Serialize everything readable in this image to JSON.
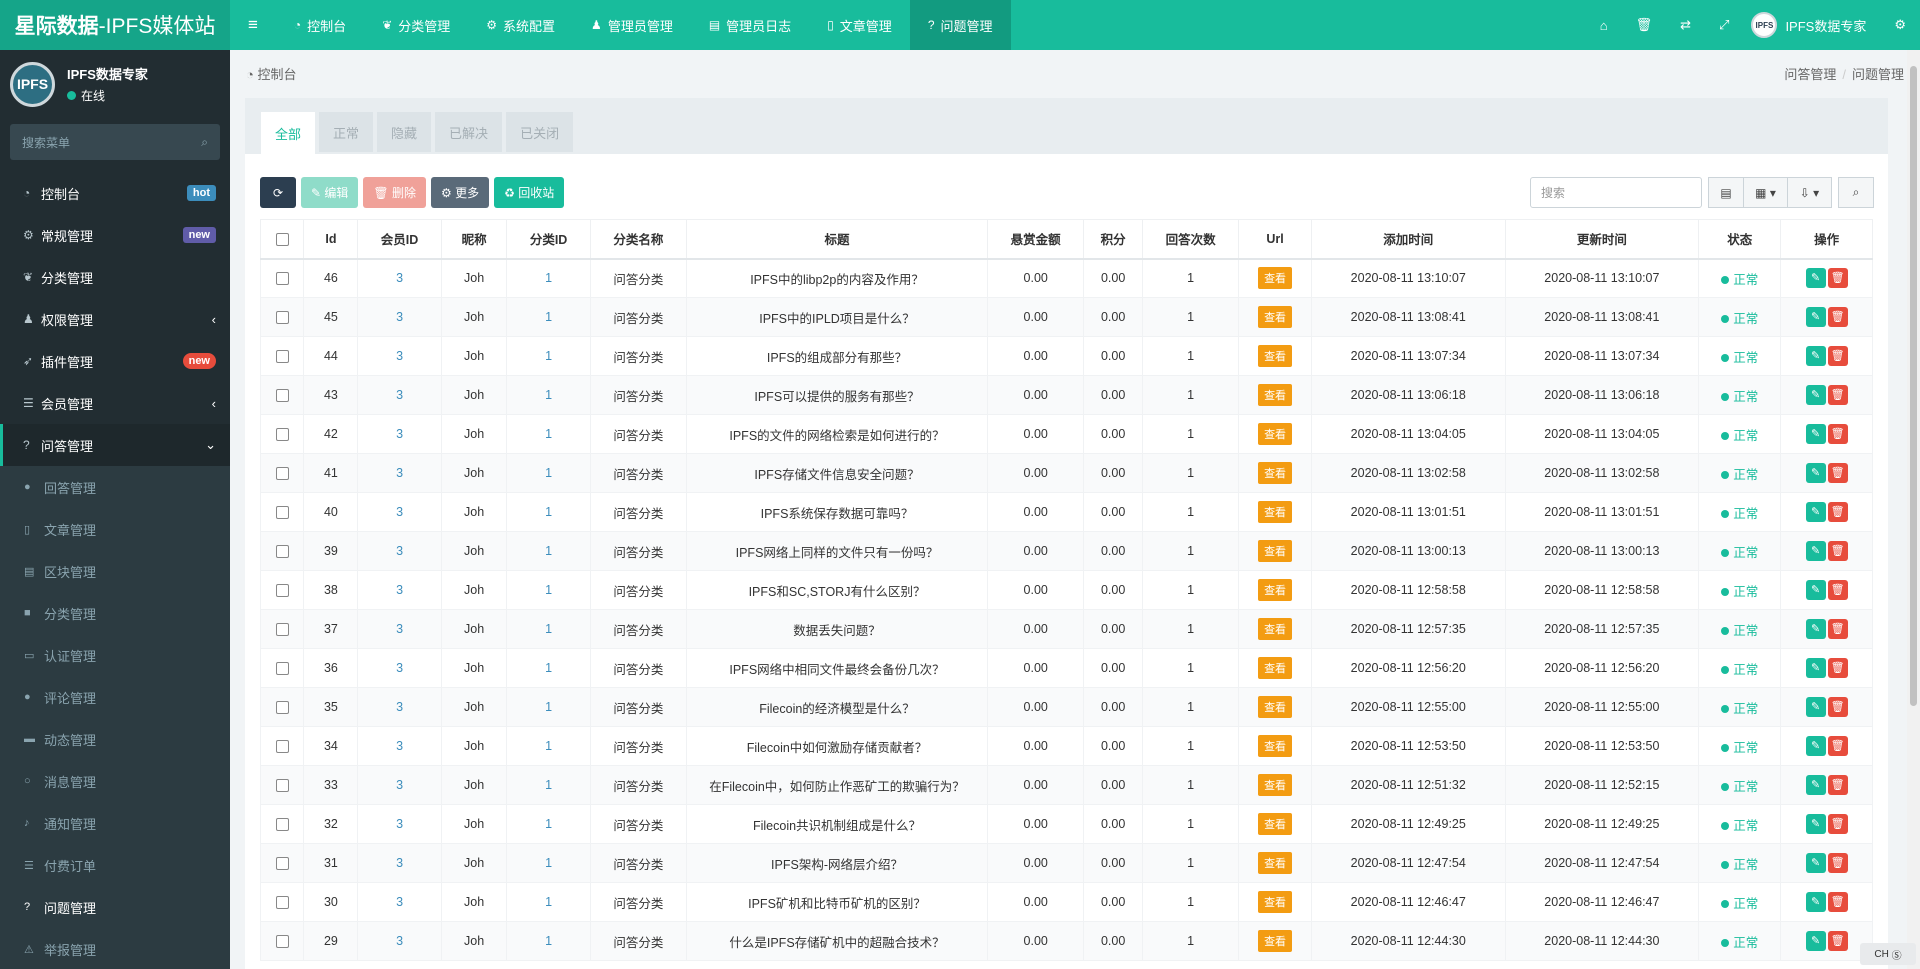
{
  "brand": {
    "part1": "星际数据",
    "part2": "-IPFS媒体站"
  },
  "topnav": [
    {
      "icon": "dashboard-icon",
      "glyph": "◔",
      "label": "控制台"
    },
    {
      "icon": "leaf-icon",
      "glyph": "❦",
      "label": "分类管理"
    },
    {
      "icon": "gear-icon",
      "glyph": "⚙",
      "label": "系统配置"
    },
    {
      "icon": "user-icon",
      "glyph": "♟",
      "label": "管理员管理"
    },
    {
      "icon": "list-icon",
      "glyph": "▤",
      "label": "管理员日志"
    },
    {
      "icon": "file-icon",
      "glyph": "▯",
      "label": "文章管理"
    },
    {
      "icon": "question-icon",
      "glyph": "?",
      "label": "问题管理"
    }
  ],
  "topright": {
    "username": "IPFS数据专家",
    "avatar_text": "IPFS"
  },
  "sidebar": {
    "user_name": "IPFS数据专家",
    "user_status": "在线",
    "avatar_text": "IPFS",
    "search_placeholder": "搜索菜单",
    "menu": [
      {
        "label": "控制台",
        "badge": "hot"
      },
      {
        "label": "常规管理",
        "badge": "new"
      },
      {
        "label": "分类管理",
        "badge": ""
      },
      {
        "label": "权限管理",
        "badge": ""
      },
      {
        "label": "插件管理",
        "badge": "new"
      },
      {
        "label": "会员管理",
        "badge": ""
      },
      {
        "label": "问答管理",
        "badge": ""
      }
    ],
    "submenu": [
      "回答管理",
      "文章管理",
      "区块管理",
      "分类管理",
      "认证管理",
      "评论管理",
      "动态管理",
      "消息管理",
      "通知管理",
      "付费订单",
      "问题管理",
      "举报管理"
    ]
  },
  "breadcrumb": {
    "left": "控制台",
    "right1": "问答管理",
    "sep": "/",
    "right2": "问题管理"
  },
  "tabs": [
    "全部",
    "正常",
    "隐藏",
    "已解决",
    "已关闭"
  ],
  "toolbar": {
    "edit": "编辑",
    "delete": "删除",
    "more": "更多",
    "recycle": "回收站"
  },
  "search_placeholder": "搜索",
  "table": {
    "headers": [
      "Id",
      "会员ID",
      "昵称",
      "分类ID",
      "分类名称",
      "标题",
      "悬赏金额",
      "积分",
      "回答次数",
      "Url",
      "添加时间",
      "更新时间",
      "状态",
      "操作"
    ],
    "url_label": "查看",
    "rows": [
      {
        "id": "46",
        "member_id": "3",
        "nickname": "Joh",
        "cat_id": "1",
        "cat_name": "问答分类",
        "title": "IPFS中的libp2p的内容及作用？",
        "reward": "0.00",
        "points": "0.00",
        "answers": "1",
        "created": "2020-08-11 13:10:07",
        "updated": "2020-08-11 13:10:07",
        "status": "正常"
      },
      {
        "id": "45",
        "member_id": "3",
        "nickname": "Joh",
        "cat_id": "1",
        "cat_name": "问答分类",
        "title": "IPFS中的IPLD项目是什么？",
        "reward": "0.00",
        "points": "0.00",
        "answers": "1",
        "created": "2020-08-11 13:08:41",
        "updated": "2020-08-11 13:08:41",
        "status": "正常"
      },
      {
        "id": "44",
        "member_id": "3",
        "nickname": "Joh",
        "cat_id": "1",
        "cat_name": "问答分类",
        "title": "IPFS的组成部分有那些？",
        "reward": "0.00",
        "points": "0.00",
        "answers": "1",
        "created": "2020-08-11 13:07:34",
        "updated": "2020-08-11 13:07:34",
        "status": "正常"
      },
      {
        "id": "43",
        "member_id": "3",
        "nickname": "Joh",
        "cat_id": "1",
        "cat_name": "问答分类",
        "title": "IPFS可以提供的服务有那些？",
        "reward": "0.00",
        "points": "0.00",
        "answers": "1",
        "created": "2020-08-11 13:06:18",
        "updated": "2020-08-11 13:06:18",
        "status": "正常"
      },
      {
        "id": "42",
        "member_id": "3",
        "nickname": "Joh",
        "cat_id": "1",
        "cat_name": "问答分类",
        "title": "IPFS的文件的网络检索是如何进行的？",
        "reward": "0.00",
        "points": "0.00",
        "answers": "1",
        "created": "2020-08-11 13:04:05",
        "updated": "2020-08-11 13:04:05",
        "status": "正常"
      },
      {
        "id": "41",
        "member_id": "3",
        "nickname": "Joh",
        "cat_id": "1",
        "cat_name": "问答分类",
        "title": "IPFS存储文件信息安全问题？",
        "reward": "0.00",
        "points": "0.00",
        "answers": "1",
        "created": "2020-08-11 13:02:58",
        "updated": "2020-08-11 13:02:58",
        "status": "正常"
      },
      {
        "id": "40",
        "member_id": "3",
        "nickname": "Joh",
        "cat_id": "1",
        "cat_name": "问答分类",
        "title": "IPFS系统保存数据可靠吗？",
        "reward": "0.00",
        "points": "0.00",
        "answers": "1",
        "created": "2020-08-11 13:01:51",
        "updated": "2020-08-11 13:01:51",
        "status": "正常"
      },
      {
        "id": "39",
        "member_id": "3",
        "nickname": "Joh",
        "cat_id": "1",
        "cat_name": "问答分类",
        "title": "IPFS网络上同样的文件只有一份吗？",
        "reward": "0.00",
        "points": "0.00",
        "answers": "1",
        "created": "2020-08-11 13:00:13",
        "updated": "2020-08-11 13:00:13",
        "status": "正常"
      },
      {
        "id": "38",
        "member_id": "3",
        "nickname": "Joh",
        "cat_id": "1",
        "cat_name": "问答分类",
        "title": "IPFS和SC,STORJ有什么区别？",
        "reward": "0.00",
        "points": "0.00",
        "answers": "1",
        "created": "2020-08-11 12:58:58",
        "updated": "2020-08-11 12:58:58",
        "status": "正常"
      },
      {
        "id": "37",
        "member_id": "3",
        "nickname": "Joh",
        "cat_id": "1",
        "cat_name": "问答分类",
        "title": "数据丢失问题？",
        "reward": "0.00",
        "points": "0.00",
        "answers": "1",
        "created": "2020-08-11 12:57:35",
        "updated": "2020-08-11 12:57:35",
        "status": "正常"
      },
      {
        "id": "36",
        "member_id": "3",
        "nickname": "Joh",
        "cat_id": "1",
        "cat_name": "问答分类",
        "title": "IPFS网络中相同文件最终会备份几次？",
        "reward": "0.00",
        "points": "0.00",
        "answers": "1",
        "created": "2020-08-11 12:56:20",
        "updated": "2020-08-11 12:56:20",
        "status": "正常"
      },
      {
        "id": "35",
        "member_id": "3",
        "nickname": "Joh",
        "cat_id": "1",
        "cat_name": "问答分类",
        "title": "Filecoin的经济模型是什么？",
        "reward": "0.00",
        "points": "0.00",
        "answers": "1",
        "created": "2020-08-11 12:55:00",
        "updated": "2020-08-11 12:55:00",
        "status": "正常"
      },
      {
        "id": "34",
        "member_id": "3",
        "nickname": "Joh",
        "cat_id": "1",
        "cat_name": "问答分类",
        "title": "Filecoin中如何激励存储贡献者？",
        "reward": "0.00",
        "points": "0.00",
        "answers": "1",
        "created": "2020-08-11 12:53:50",
        "updated": "2020-08-11 12:53:50",
        "status": "正常"
      },
      {
        "id": "33",
        "member_id": "3",
        "nickname": "Joh",
        "cat_id": "1",
        "cat_name": "问答分类",
        "title": "在Filecoin中，如何防止作恶矿工的欺骗行为？",
        "reward": "0.00",
        "points": "0.00",
        "answers": "1",
        "created": "2020-08-11 12:51:32",
        "updated": "2020-08-11 12:52:15",
        "status": "正常"
      },
      {
        "id": "32",
        "member_id": "3",
        "nickname": "Joh",
        "cat_id": "1",
        "cat_name": "问答分类",
        "title": "Filecoin共识机制组成是什么？",
        "reward": "0.00",
        "points": "0.00",
        "answers": "1",
        "created": "2020-08-11 12:49:25",
        "updated": "2020-08-11 12:49:25",
        "status": "正常"
      },
      {
        "id": "31",
        "member_id": "3",
        "nickname": "Joh",
        "cat_id": "1",
        "cat_name": "问答分类",
        "title": "IPFS架构-网络层介绍？",
        "reward": "0.00",
        "points": "0.00",
        "answers": "1",
        "created": "2020-08-11 12:47:54",
        "updated": "2020-08-11 12:47:54",
        "status": "正常"
      },
      {
        "id": "30",
        "member_id": "3",
        "nickname": "Joh",
        "cat_id": "1",
        "cat_name": "问答分类",
        "title": "IPFS矿机和比特币矿机的区别？",
        "reward": "0.00",
        "points": "0.00",
        "answers": "1",
        "created": "2020-08-11 12:46:47",
        "updated": "2020-08-11 12:46:47",
        "status": "正常"
      },
      {
        "id": "29",
        "member_id": "3",
        "nickname": "Joh",
        "cat_id": "1",
        "cat_name": "问答分类",
        "title": "什么是IPFS存储矿机中的超融合技术？",
        "reward": "0.00",
        "points": "0.00",
        "answers": "1",
        "created": "2020-08-11 12:44:30",
        "updated": "2020-08-11 12:44:30",
        "status": "正常"
      }
    ]
  },
  "ime": {
    "label": "CH"
  },
  "colors": {
    "primary": "#18bc9c",
    "sidebar": "#222d32",
    "danger": "#e74c3c",
    "warning": "#f39c12",
    "link": "#3c8dbc"
  }
}
